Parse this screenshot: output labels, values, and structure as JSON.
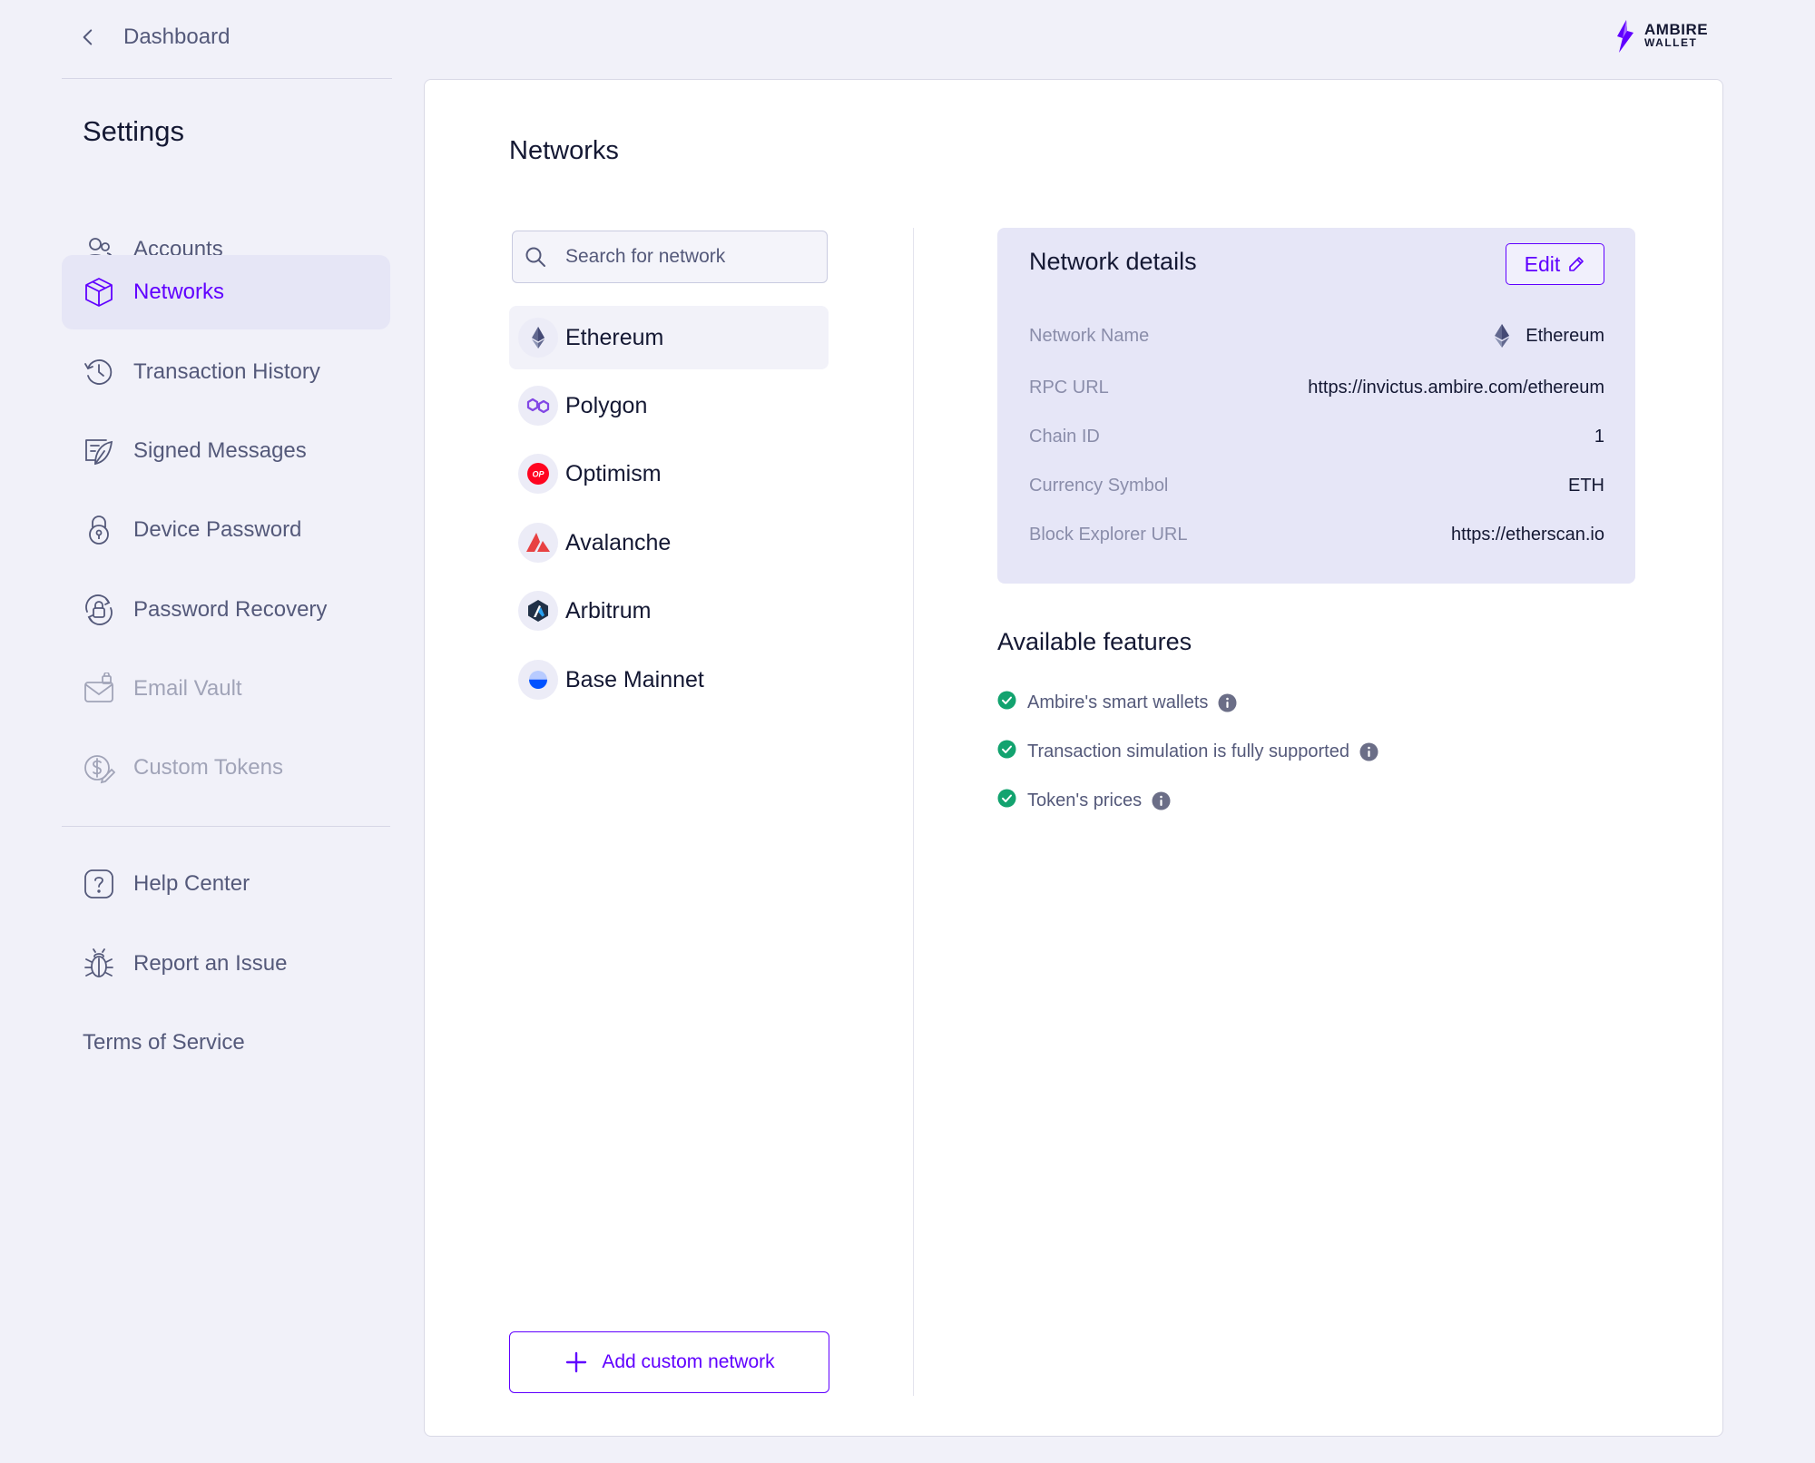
{
  "header": {
    "back_label": "Dashboard",
    "logo_line1": "AMBIRE",
    "logo_line2": "WALLET"
  },
  "sidebar": {
    "title": "Settings",
    "items": [
      {
        "label": "Accounts",
        "icon": "accounts-icon",
        "state": "normal"
      },
      {
        "label": "Networks",
        "icon": "networks-icon",
        "state": "active"
      },
      {
        "label": "Transaction History",
        "icon": "history-icon",
        "state": "normal"
      },
      {
        "label": "Signed Messages",
        "icon": "signed-messages-icon",
        "state": "normal"
      },
      {
        "label": "Device Password",
        "icon": "lock-icon",
        "state": "normal"
      },
      {
        "label": "Password Recovery",
        "icon": "password-recovery-icon",
        "state": "normal"
      },
      {
        "label": "Email Vault",
        "icon": "email-vault-icon",
        "state": "disabled"
      },
      {
        "label": "Custom Tokens",
        "icon": "custom-tokens-icon",
        "state": "disabled"
      }
    ],
    "footer_items": [
      {
        "label": "Help Center",
        "icon": "help-icon"
      },
      {
        "label": "Report an Issue",
        "icon": "bug-icon"
      },
      {
        "label": "Terms of Service"
      }
    ]
  },
  "main": {
    "title": "Networks",
    "search_placeholder": "Search for network",
    "networks": [
      {
        "name": "Ethereum",
        "icon": "ethereum-icon",
        "selected": true
      },
      {
        "name": "Polygon",
        "icon": "polygon-icon",
        "selected": false
      },
      {
        "name": "Optimism",
        "icon": "optimism-icon",
        "selected": false
      },
      {
        "name": "Avalanche",
        "icon": "avalanche-icon",
        "selected": false
      },
      {
        "name": "Arbitrum",
        "icon": "arbitrum-icon",
        "selected": false
      },
      {
        "name": "Base Mainnet",
        "icon": "base-icon",
        "selected": false
      }
    ],
    "add_button_label": "Add custom network",
    "details": {
      "title": "Network details",
      "edit_label": "Edit",
      "rows": [
        {
          "key": "Network Name",
          "value": "Ethereum"
        },
        {
          "key": "RPC URL",
          "value": "https://invictus.ambire.com/ethereum"
        },
        {
          "key": "Chain ID",
          "value": "1"
        },
        {
          "key": "Currency Symbol",
          "value": "ETH"
        },
        {
          "key": "Block Explorer URL",
          "value": "https://etherscan.io"
        }
      ]
    },
    "features": {
      "title": "Available features",
      "items": [
        {
          "label": "Ambire's smart wallets",
          "status": "supported"
        },
        {
          "label": "Transaction simulation is fully supported",
          "status": "supported"
        },
        {
          "label": "Token's prices",
          "status": "supported"
        }
      ]
    }
  },
  "colors": {
    "background": "#f1f1f9",
    "accent": "#6000ff",
    "text_dark": "#141833",
    "text_muted": "#54597a",
    "success": "#13a36f",
    "active_bg": "#e6e6f6"
  }
}
